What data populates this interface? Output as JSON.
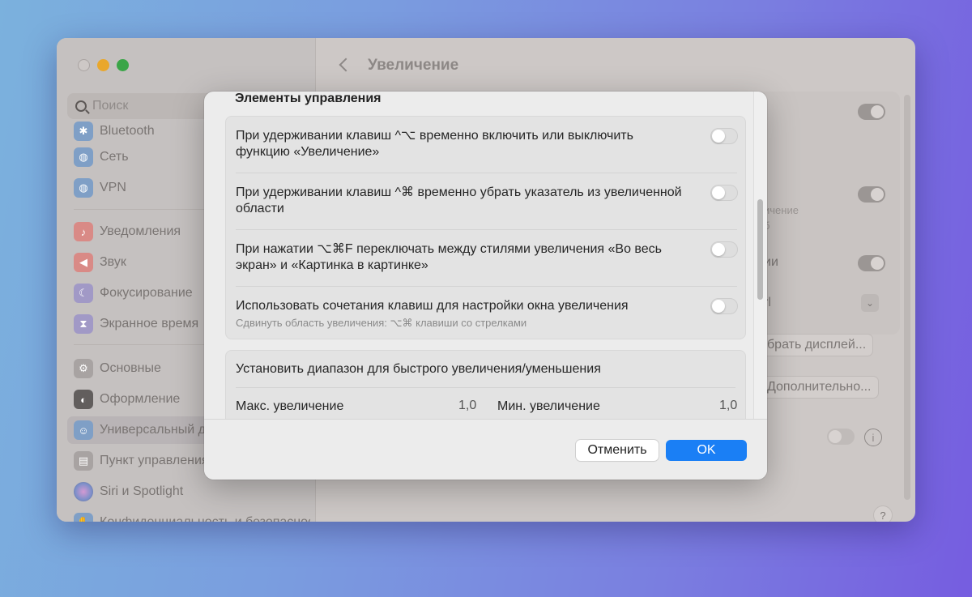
{
  "window": {
    "title": "Увеличение",
    "search_placeholder": "Поиск"
  },
  "sidebar": {
    "items": [
      {
        "label": "Bluetooth",
        "icon": "bluetooth-icon"
      },
      {
        "label": "Сеть",
        "icon": "globe-icon"
      },
      {
        "label": "VPN",
        "icon": "globe-icon"
      },
      {
        "label": "Уведомления",
        "icon": "bell-icon"
      },
      {
        "label": "Звук",
        "icon": "speaker-icon"
      },
      {
        "label": "Фокусирование",
        "icon": "moon-icon"
      },
      {
        "label": "Экранное время",
        "icon": "hourglass-icon"
      },
      {
        "label": "Основные",
        "icon": "gear-icon"
      },
      {
        "label": "Оформление",
        "icon": "appearance-icon"
      },
      {
        "label": "Универсальный доступ",
        "icon": "accessibility-icon"
      },
      {
        "label": "Пункт управления",
        "icon": "control-center-icon"
      },
      {
        "label": "Siri и Spotlight",
        "icon": "siri-icon"
      },
      {
        "label": "Конфиденциальность и безопасность",
        "icon": "hand-icon"
      }
    ]
  },
  "background": {
    "partial_texts": [
      "ичение",
      "б",
      "ии",
      "rl"
    ],
    "choose_display_button": "брать дисплей...",
    "advanced_button": "Дополнительно...",
    "info_glyph": "i",
    "help_glyph": "?"
  },
  "dialog": {
    "section_title": "Элементы управления",
    "controls": [
      {
        "text": "При удерживании клавиш ^⌥ временно включить или выключить функцию «Увеличение»",
        "enabled": false
      },
      {
        "text": "При удерживании клавиш ^⌘ временно убрать указатель из увеличенной области",
        "enabled": false
      },
      {
        "text": "При нажатии ⌥⌘F переключать между стилями увеличения «Во весь экран» и «Картинка в картинке»",
        "enabled": false
      },
      {
        "text": "Использовать сочетания клавиш для настройки окна увеличения",
        "subtitle": "Сдвинуть область увеличения: ⌥⌘ клавиши со стрелками",
        "enabled": false
      }
    ],
    "range": {
      "title": "Установить диапазон для быстрого увеличения/уменьшения",
      "max_label": "Макс. увеличение",
      "max_value": "1,0",
      "min_label": "Мин. увеличение",
      "min_value": "1,0"
    },
    "cancel_label": "Отменить",
    "ok_label": "OK"
  },
  "colors": {
    "accent": "#1a7ff5",
    "tl_close": "#cdc8c6",
    "tl_minimize": "#e9a72b",
    "tl_maximize": "#3aa547"
  }
}
